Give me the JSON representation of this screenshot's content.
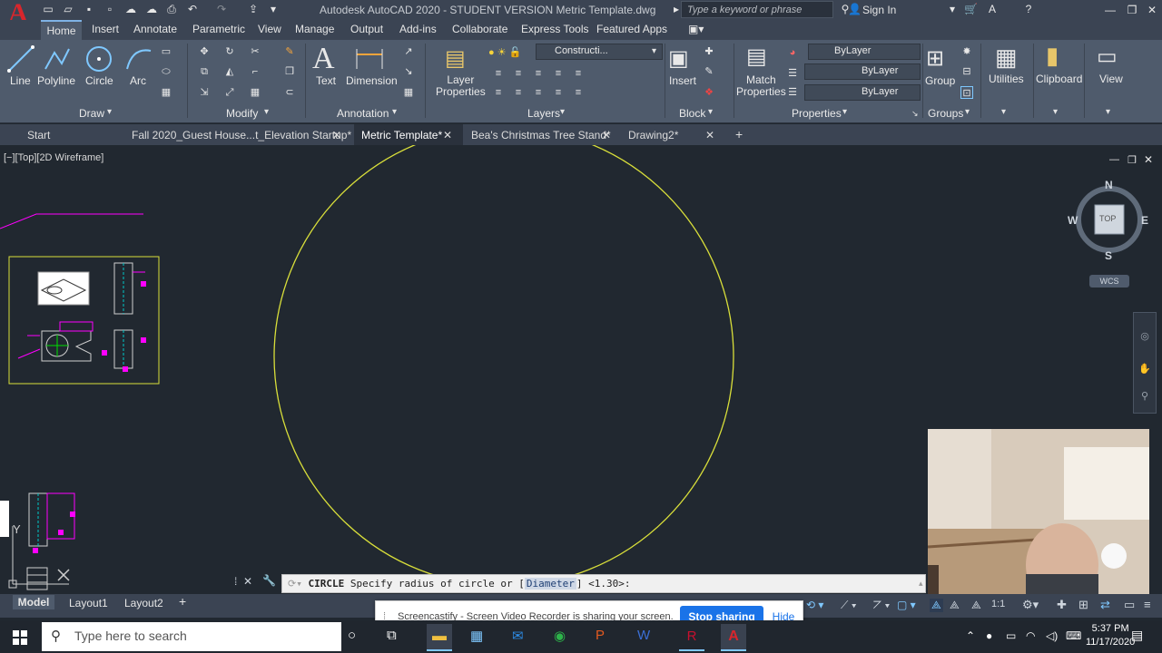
{
  "titlebar": {
    "title": "Autodesk AutoCAD 2020 - STUDENT VERSION    Metric Template.dwg",
    "search_placeholder": "Type a keyword or phrase",
    "sign_in": "Sign In"
  },
  "ribbon_tabs": [
    "Home",
    "Insert",
    "Annotate",
    "Parametric",
    "View",
    "Manage",
    "Output",
    "Add-ins",
    "Collaborate",
    "Express Tools",
    "Featured Apps"
  ],
  "draw": {
    "line": "Line",
    "polyline": "Polyline",
    "circle": "Circle",
    "arc": "Arc",
    "panel": "Draw"
  },
  "modify": {
    "panel": "Modify"
  },
  "annotation": {
    "text": "Text",
    "dimension": "Dimension",
    "panel": "Annotation"
  },
  "layers": {
    "layer_properties": "Layer\nProperties",
    "current_layer": "Constructi...",
    "panel": "Layers"
  },
  "block": {
    "insert": "Insert",
    "panel": "Block"
  },
  "properties": {
    "match": "Match\nProperties",
    "color": "ByLayer",
    "linetype": "ByLayer",
    "lineweight": "ByLayer",
    "panel": "Properties"
  },
  "groups": {
    "group": "Group",
    "panel": "Groups"
  },
  "utilities": "Utilities",
  "clipboard": "Clipboard",
  "view": "View",
  "file_tabs": [
    "Start",
    "Fall 2020_Guest House...t_Elevation Startup*",
    "Metric Template*",
    "Bea's Christmas Tree Stand*",
    "Drawing2*"
  ],
  "viewport_label": "[−][Top][2D Wireframe]",
  "viewcube": {
    "n": "N",
    "s": "S",
    "e": "E",
    "w": "W",
    "top": "TOP",
    "wcs": "WCS"
  },
  "command": {
    "name": "CIRCLE",
    "prompt": " Specify radius of circle or [",
    "option": "Diameter",
    "suffix": "] <1.30>:"
  },
  "layout_tabs": [
    "Model",
    "Layout1",
    "Layout2"
  ],
  "status": {
    "scale": "1:1"
  },
  "share": {
    "message": "Screencastify - Screen Video Recorder is sharing your screen.",
    "stop": "Stop sharing",
    "hide": "Hide"
  },
  "taskbar": {
    "search_placeholder": "Type here to search",
    "time": "5:37 PM",
    "date": "11/17/2020"
  },
  "colors": {
    "accent": "#1a73e8",
    "circle": "#d9df3a",
    "magenta": "#ff00ff",
    "canvas": "#212830"
  }
}
